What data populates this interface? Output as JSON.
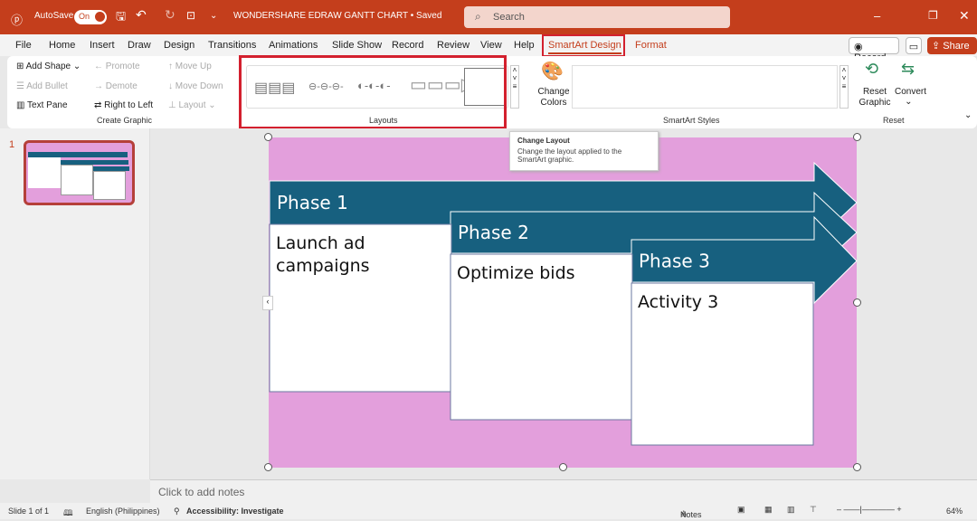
{
  "titlebar": {
    "autosave": "AutoSave",
    "toggle": "On",
    "doc_title": "WONDERSHARE EDRAW GANTT CHART • Saved",
    "search_placeholder": "Search"
  },
  "tabs": [
    "File",
    "Home",
    "Insert",
    "Draw",
    "Design",
    "Transitions",
    "Animations",
    "Slide Show",
    "Record",
    "Review",
    "View",
    "Help",
    "SmartArt Design",
    "Format"
  ],
  "actions": {
    "record": "Record",
    "share": "Share"
  },
  "ribbon": {
    "create_graphic": {
      "add_shape": "Add Shape",
      "add_bullet": "Add Bullet",
      "text_pane": "Text Pane",
      "promote": "Promote",
      "demote": "Demote",
      "right_to_left": "Right to Left",
      "move_up": "Move Up",
      "move_down": "Move Down",
      "layout": "Layout",
      "label": "Create Graphic"
    },
    "layouts": {
      "label": "Layouts"
    },
    "change_colors": "Change Colors",
    "styles": {
      "label": "SmartArt Styles"
    },
    "reset": {
      "reset_graphic": "Reset Graphic",
      "convert": "Convert",
      "label": "Reset"
    }
  },
  "tooltip": {
    "title": "Change Layout",
    "body": "Change the layout applied to the SmartArt graphic."
  },
  "slide_thumb": {
    "number": "1"
  },
  "slide": {
    "background": "#e39fdc",
    "accent": "#17607f",
    "phases": [
      {
        "title": "Phase 1",
        "text": "Launch ad campaigns"
      },
      {
        "title": "Phase 2",
        "text": "Optimize bids"
      },
      {
        "title": "Phase 3",
        "text": "Activity 3"
      }
    ]
  },
  "notes_placeholder": "Click to add notes",
  "status": {
    "slide": "Slide 1 of 1",
    "language": "English (Philippines)",
    "accessibility": "Accessibility: Investigate",
    "notes": "Notes",
    "zoom": "64%"
  }
}
